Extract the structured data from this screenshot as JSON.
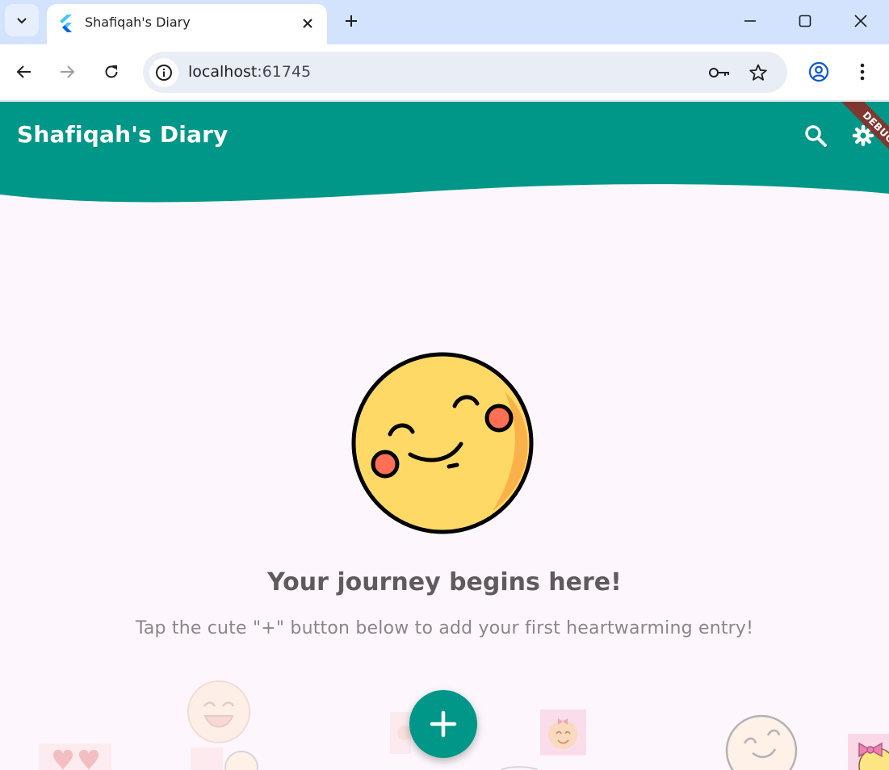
{
  "browser": {
    "tab": {
      "title": "Shafiqah's Diary"
    },
    "url": {
      "host": "localhost",
      "port": ":61745"
    }
  },
  "app": {
    "title": "Shafiqah's Diary",
    "debug_banner": "DEBUG",
    "empty_state": {
      "title": "Your journey begins here!",
      "subtitle": "Tap the cute \"+\" button below to add your first heartwarming entry!"
    }
  },
  "colors": {
    "appbar": "#009688",
    "background": "#fdf7fd",
    "fab": "#009688",
    "emoji_face": "#ffd966"
  },
  "icons": [
    "tab-search-icon",
    "flutter-favicon-icon",
    "close-icon",
    "plus-icon",
    "minimize-icon",
    "maximize-icon",
    "window-close-icon",
    "back-arrow-icon",
    "forward-arrow-icon",
    "reload-icon",
    "info-icon",
    "key-icon",
    "star-icon",
    "profile-icon",
    "kebab-menu-icon",
    "search-icon",
    "gear-icon",
    "smiley-icon",
    "add-icon"
  ]
}
